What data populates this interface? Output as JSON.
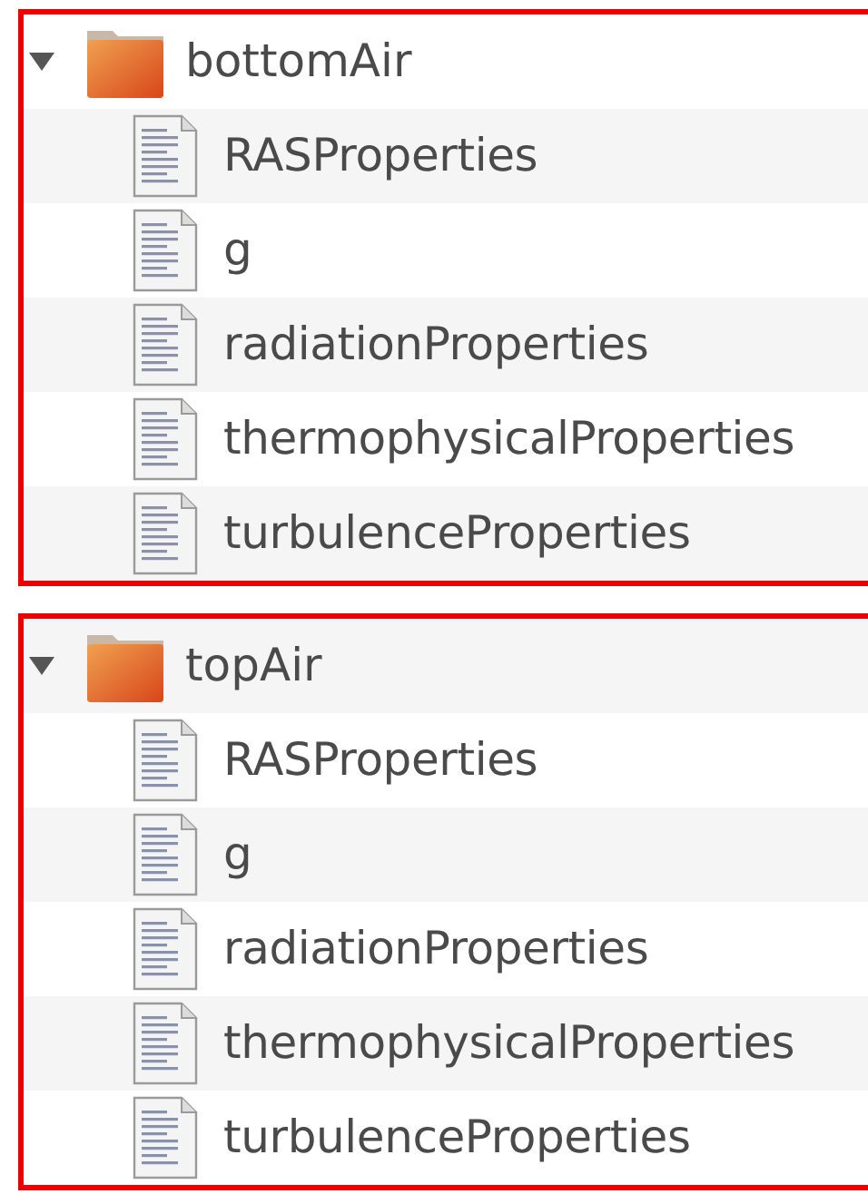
{
  "folders": [
    {
      "name": "bottomAir",
      "expanded": true,
      "children": [
        {
          "name": "RASProperties"
        },
        {
          "name": "g"
        },
        {
          "name": "radiationProperties"
        },
        {
          "name": "thermophysicalProperties"
        },
        {
          "name": "turbulenceProperties"
        }
      ]
    },
    {
      "name": "topAir",
      "expanded": true,
      "children": [
        {
          "name": "RASProperties"
        },
        {
          "name": "g"
        },
        {
          "name": "radiationProperties"
        },
        {
          "name": "thermophysicalProperties"
        },
        {
          "name": "turbulenceProperties"
        }
      ]
    }
  ]
}
